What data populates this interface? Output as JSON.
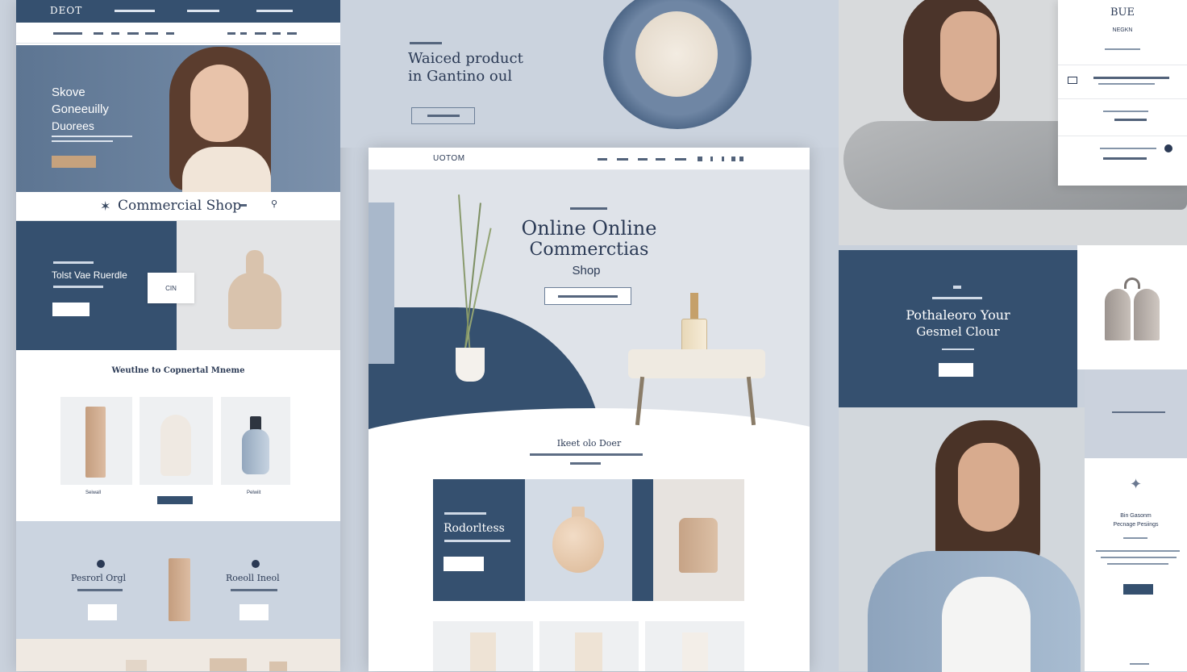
{
  "colors": {
    "navy": "#35506f",
    "accent": "#c6a27d",
    "bg": "#c9d1dc"
  },
  "left": {
    "brand": "DEOT",
    "hero": {
      "line1": "Skove",
      "line2": "Goneeuilly",
      "line3": "Duorees"
    },
    "shop": {
      "title": "Commercial Shop"
    },
    "promo": {
      "title": "Tolst Vae Ruerdle",
      "cta": "CIN"
    },
    "featured": {
      "title": "Weutlne to Copnertal Mneme",
      "labels": [
        "Seiwall",
        "Pelwiit"
      ]
    },
    "bottom": {
      "left": "Pesrorl Orgl",
      "right": "Roeoll Ineol"
    }
  },
  "center": {
    "hero": {
      "line1": "Waiced product",
      "line2": "in Gantino oul"
    },
    "site": {
      "brand": "UOTOM",
      "line1": "Online Online",
      "line2": "Commerctias",
      "line3": "Shop"
    },
    "new": {
      "title": "Ikeet olo Doer"
    },
    "feature": {
      "title": "Rodorltess"
    }
  },
  "right": {
    "brand": "BUE",
    "brand_sub": "NEGKN",
    "promo": {
      "line1": "Pothaleoro Your",
      "line2": "Gesmel Clour"
    },
    "side": {
      "line1": "Bin Gasonm",
      "line2": "Pecnage Pesiings"
    }
  }
}
